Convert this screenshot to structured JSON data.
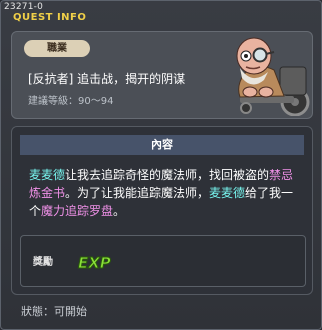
{
  "header": {
    "quest_id": "23271-0",
    "title": "QUEST INFO"
  },
  "info": {
    "job_badge": "職業",
    "quest_name": "[反抗者] 追击战，揭开的阴谋",
    "level": "建議等級：90～94",
    "npc_icon": "bald-old-man-in-wheelchair-portrait"
  },
  "content": {
    "header": "內容",
    "description": {
      "p1_npc": "麦麦德",
      "p2": "让我去追踪奇怪的魔法师，找回被盗的",
      "p3_item": "禁忌炼金书",
      "p4": "。为了让我能追踪魔法师，",
      "p5_npc": "麦麦德",
      "p6": "给了我一个",
      "p7_item": "魔力追踪罗盘",
      "p8": "。"
    },
    "reward": {
      "label": "獎勵",
      "icon": "exp-icon"
    }
  },
  "status": {
    "text": "狀態：可開始"
  },
  "colors": {
    "title": "#f0d048",
    "npc_highlight": "#78f7f0",
    "item_highlight": "#f091e8",
    "exp_green": "#8be03a"
  }
}
